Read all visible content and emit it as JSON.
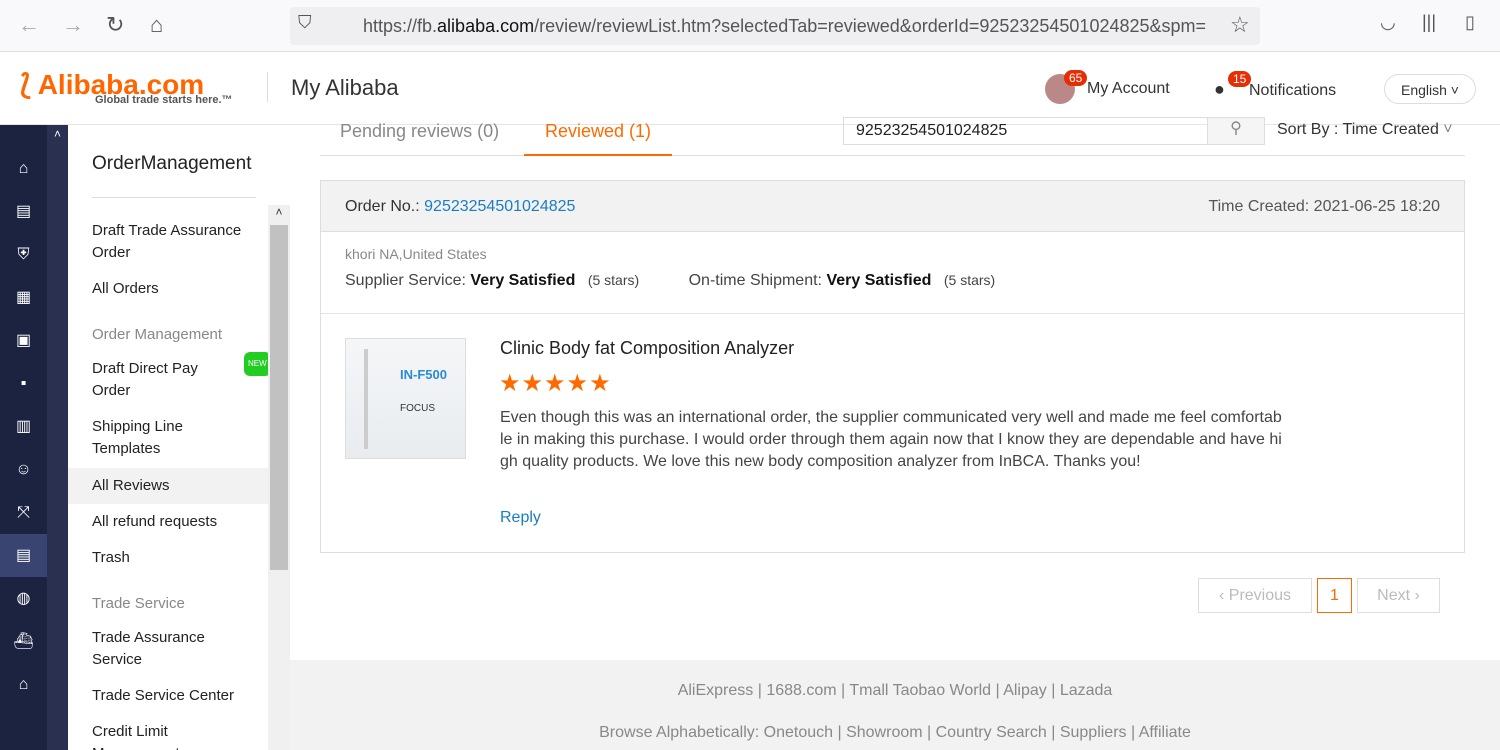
{
  "browser": {
    "url_prefix": "https://fb.",
    "url_domain": "alibaba.com",
    "url_rest": "/review/reviewList.htm?selectedTab=reviewed&orderId=92523254501024825&spm="
  },
  "header": {
    "logo": "Alibaba.com",
    "logo_tagline": "Global trade starts here.™",
    "title": "My Alibaba",
    "account_badge": "65",
    "account_label": "My Account",
    "notif_badge": "15",
    "notif_label": "Notifications",
    "language": "English"
  },
  "sidebar": {
    "title": "OrderManagement",
    "items": [
      {
        "label": "Draft Trade Assurance Order"
      },
      {
        "label": "All Orders"
      },
      {
        "label": "Order Management",
        "group": true
      },
      {
        "label": "Draft Direct Pay Order",
        "badge": "NEW"
      },
      {
        "label": "Shipping Line Templates"
      },
      {
        "label": "All Reviews",
        "selected": true
      },
      {
        "label": "All refund requests"
      },
      {
        "label": "Trash"
      },
      {
        "label": "Trade Service",
        "group": true
      },
      {
        "label": "Trade Assurance Service"
      },
      {
        "label": "Trade Service Center"
      },
      {
        "label": "Credit Limit Management"
      }
    ]
  },
  "tabs": [
    {
      "label": "Pending reviews (0)"
    },
    {
      "label": "Reviewed (1)",
      "active": true
    }
  ],
  "search": {
    "value": "92523254501024825"
  },
  "sort": {
    "label": "Sort By : Time Created"
  },
  "order": {
    "no_label": "Order No.:",
    "no": "92523254501024825",
    "time_label": "Time Created:",
    "time": "2021-06-25 18:20",
    "buyer": "khori NA,United States",
    "supplier_label": "Supplier Service:",
    "supplier_value": "Very Satisfied",
    "supplier_stars": "(5 stars)",
    "ship_label": "On-time Shipment:",
    "ship_value": "Very Satisfied",
    "ship_stars": "(5 stars)"
  },
  "review": {
    "product": "Clinic Body fat Composition Analyzer",
    "rating": 5,
    "image_text": "IN-F500",
    "image_sub": "FOCUS",
    "text": "Even though this was an international order, the supplier communicated very well and made me feel comfortable in making this purchase. I would order through them again now that I know they are dependable and have high quality products. We love this new body composition analyzer from InBCA. Thanks you!",
    "reply": "Reply"
  },
  "pagination": {
    "prev": "Previous",
    "page": "1",
    "next": "Next"
  },
  "footer": {
    "line1": "AliExpress | 1688.com | Tmall Taobao World | Alipay | Lazada",
    "line2": "Browse Alphabetically: Onetouch | Showroom | Country Search | Suppliers | Affiliate"
  },
  "colors": {
    "accent": "#ff6a00",
    "link": "#1a7dc4",
    "nav": "#1c2340"
  }
}
